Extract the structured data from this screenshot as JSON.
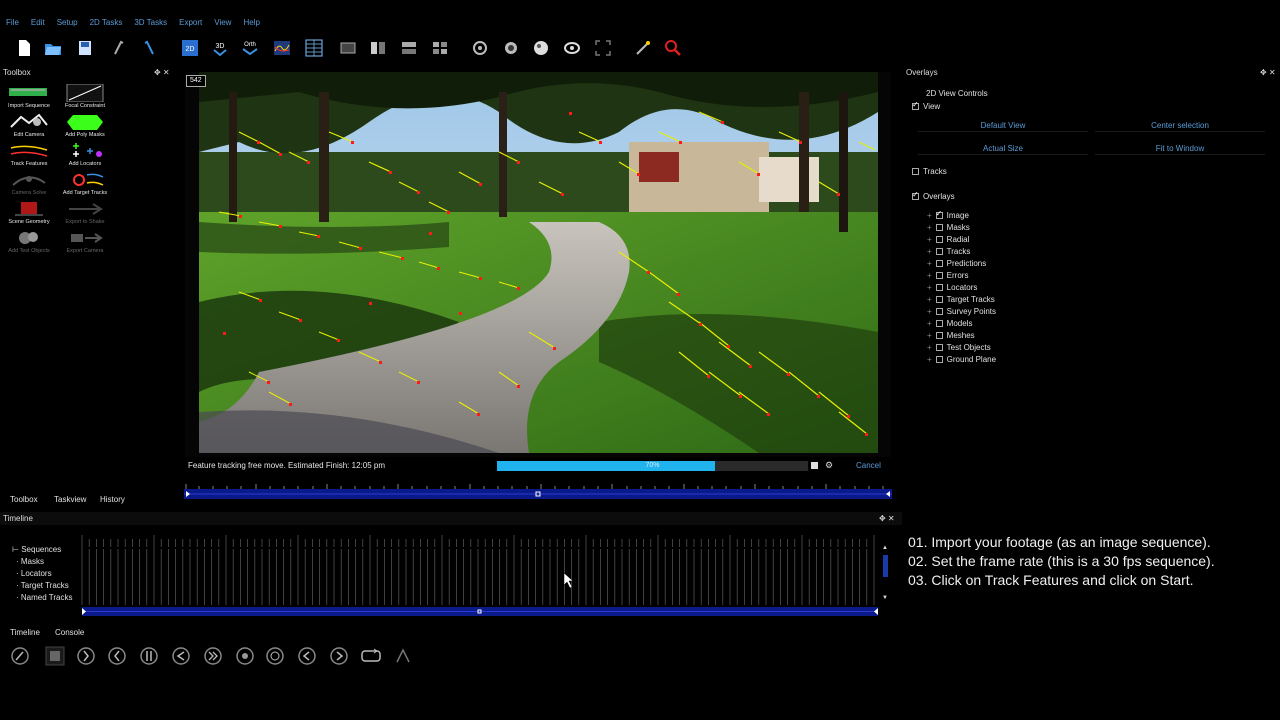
{
  "menu": [
    "File",
    "Edit",
    "Setup",
    "2D Tasks",
    "3D Tasks",
    "Export",
    "View",
    "Help"
  ],
  "toolbar": [
    {
      "icon": "new-file-icon"
    },
    {
      "icon": "open-folder-icon"
    },
    {
      "icon": "save-icon"
    },
    {
      "icon": "undo-icon"
    },
    {
      "icon": "redo-icon"
    },
    {
      "icon": "view-2d-icon",
      "label": "2D"
    },
    {
      "icon": "view-3d-icon",
      "label": "3D"
    },
    {
      "icon": "ortho-view-icon",
      "label": "Orth"
    },
    {
      "icon": "graph-editor-icon"
    },
    {
      "icon": "grid-layout-icon"
    },
    {
      "icon": "layout-single-icon"
    },
    {
      "icon": "layout-split-icon"
    },
    {
      "icon": "layout-stack-icon"
    },
    {
      "icon": "layout-quad-icon"
    },
    {
      "icon": "pan-tool-icon"
    },
    {
      "icon": "orbit-tool-icon"
    },
    {
      "icon": "sphere-tool-icon"
    },
    {
      "icon": "eye-tool-icon"
    },
    {
      "icon": "frame-select-icon"
    },
    {
      "icon": "magic-wand-icon"
    },
    {
      "icon": "zoom-tool-icon"
    }
  ],
  "toolbox": {
    "title": "Toolbox",
    "items": [
      {
        "label": "Import Sequence",
        "enabled": true
      },
      {
        "label": "Focal Constraint",
        "enabled": true
      },
      {
        "label": "Edit Camera",
        "enabled": true
      },
      {
        "label": "Add Poly Masks",
        "enabled": true
      },
      {
        "label": "Track Features",
        "enabled": true
      },
      {
        "label": "Add Locators",
        "enabled": true
      },
      {
        "label": "Camera Solve",
        "enabled": false
      },
      {
        "label": "Add Target Tracks",
        "enabled": true
      },
      {
        "label": "Scene Geometry",
        "enabled": true
      },
      {
        "label": "Export to Shake",
        "enabled": false
      },
      {
        "label": "Add Test Objects",
        "enabled": false
      },
      {
        "label": "Export Camera",
        "enabled": false
      }
    ]
  },
  "viewport": {
    "frame": "542"
  },
  "status": {
    "message": "Feature tracking free move. Estimated Finish: 12:05 pm",
    "progress_percent": 70,
    "progress_label": "70%",
    "cancel_label": "Cancel"
  },
  "left_tabs": [
    "Toolbox",
    "Taskview",
    "History"
  ],
  "timeline": {
    "title": "Timeline",
    "tracks": [
      "Sequences",
      "Masks",
      "Locators",
      "Target Tracks",
      "Named Tracks"
    ],
    "tabs": [
      "Timeline",
      "Console"
    ]
  },
  "overlays": {
    "title": "Overlays",
    "view_controls_title": "2D View Controls",
    "view_label": "View",
    "view_checked": true,
    "buttons": [
      "Default View",
      "Center selection",
      "Actual Size",
      "Fit to Window"
    ],
    "tracks_label": "Tracks",
    "tracks_checked": false,
    "overlays_label": "Overlays",
    "overlays_checked": true,
    "items": [
      {
        "label": "Image",
        "checked": true
      },
      {
        "label": "Masks",
        "checked": false
      },
      {
        "label": "Radial",
        "checked": false
      },
      {
        "label": "Tracks",
        "checked": false
      },
      {
        "label": "Predictions",
        "checked": false
      },
      {
        "label": "Errors",
        "checked": false
      },
      {
        "label": "Locators",
        "checked": false
      },
      {
        "label": "Target Tracks",
        "checked": false
      },
      {
        "label": "Survey Points",
        "checked": false
      },
      {
        "label": "Models",
        "checked": false
      },
      {
        "label": "Meshes",
        "checked": false
      },
      {
        "label": "Test Objects",
        "checked": false
      },
      {
        "label": "Ground Plane",
        "checked": false
      }
    ]
  },
  "instructions": [
    "01. Import your footage (as an image sequence).",
    "02. Set the frame rate (this is a 30 fps sequence).",
    "03. Click on Track Features and click on Start."
  ],
  "playback": [
    {
      "icon": "go-start-icon"
    },
    {
      "icon": "stop-icon"
    },
    {
      "icon": "play-forward-icon"
    },
    {
      "icon": "step-back-icon"
    },
    {
      "icon": "pause-icon"
    },
    {
      "icon": "play-reverse-icon"
    },
    {
      "icon": "fast-forward-icon"
    },
    {
      "icon": "key-back-icon"
    },
    {
      "icon": "key-forward-icon"
    },
    {
      "icon": "prev-key-icon"
    },
    {
      "icon": "next-key-icon"
    },
    {
      "icon": "loop-icon"
    },
    {
      "icon": "bounce-icon"
    }
  ],
  "colors": {
    "menu_text": "#5b9bd5",
    "progress_fill": "#21b3ee",
    "track_point": "#ff1a1a",
    "track_trail": "#e8f000"
  }
}
